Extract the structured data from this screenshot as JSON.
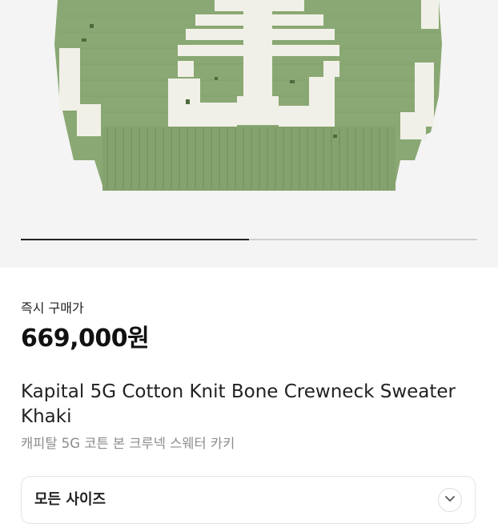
{
  "price": {
    "label": "즉시 구매가",
    "value": "669,000원"
  },
  "product": {
    "title_en": "Kapital 5G Cotton Knit Bone Crewneck Sweater Khaki",
    "title_ko": "캐피탈 5G 코튼 본 크루넥 스웨터 카키"
  },
  "carousel": {
    "progress_fraction": 0.5
  },
  "size_selector": {
    "label": "모든 사이즈",
    "icon": "chevron-down-icon"
  },
  "colors": {
    "sweater_khaki": "#8aa873",
    "bone_white": "#f1f0e8"
  }
}
